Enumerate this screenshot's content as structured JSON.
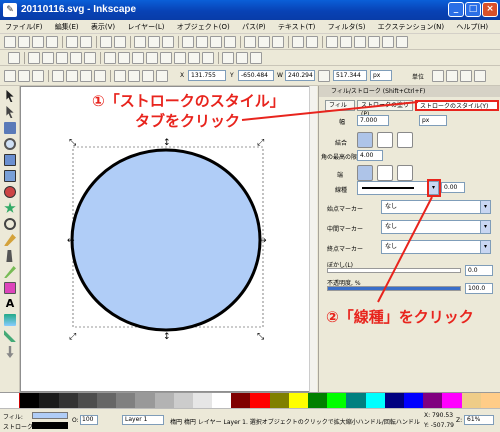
{
  "window": {
    "title": "20110116.svg - Inkscape",
    "minimize": "_",
    "maximize": "□",
    "close": "×"
  },
  "menu": [
    "ファイル(F)",
    "編集(E)",
    "表示(V)",
    "レイヤー(L)",
    "オブジェクト(O)",
    "パス(P)",
    "テキスト(T)",
    "フィルタ(S)",
    "エクステンション(N)",
    "ヘルプ(H)"
  ],
  "toolbar3": {
    "x_label": "X",
    "x_value": "131.755",
    "y_label": "Y",
    "y_value": "-650.484",
    "w_label": "W",
    "w_value": "240.294",
    "h_value": "517.344",
    "unit": "px",
    "lock": "単位"
  },
  "panel": {
    "title": "フィル/ストローク (Shift+Ctrl+F)",
    "tabs": [
      "フィル",
      "ストロークの塗り(P)",
      "ストロークのスタイル(Y)"
    ],
    "width_label": "幅",
    "width_value": "7.000",
    "width_unit": "px",
    "join_label": "結合",
    "miter_label": "角の最高の限界",
    "miter_value": "4.00",
    "cap_label": "端",
    "dash_label": "線種",
    "dash_offset": "0.00",
    "start_marker_label": "始点マーカー",
    "start_marker_value": "なし",
    "mid_marker_label": "中間マーカー",
    "mid_marker_value": "なし",
    "end_marker_label": "終点マーカー",
    "end_marker_value": "なし",
    "blur_label": "ぼかし(L)",
    "blur_value": "0.0",
    "opacity_label": "不透明度, %",
    "opacity_value": "100.0"
  },
  "status": {
    "fill_label": "フィル:",
    "stroke_label": "ストローク:",
    "opacity_label": "O:",
    "opacity_value": "100",
    "layer": "Layer 1",
    "message": "楕円 楕円 レイヤー Layer 1. 選択オブジェクトのクリックで拡大縮小ハンドル/回転ハンドルを切",
    "x_coord": "X: 790.53",
    "y_coord": "Y: -507.79",
    "zoom_label": "Z:",
    "zoom_value": "61%"
  },
  "annotations": {
    "step1_line1": "①「ストロークのスタイル」",
    "step1_line2": "タブをクリック",
    "step2": "②「線種」をクリック"
  },
  "colors": {
    "accent": "#e8241d",
    "circle_fill": "#b0cdf7",
    "titlebar": "#0842b5"
  }
}
